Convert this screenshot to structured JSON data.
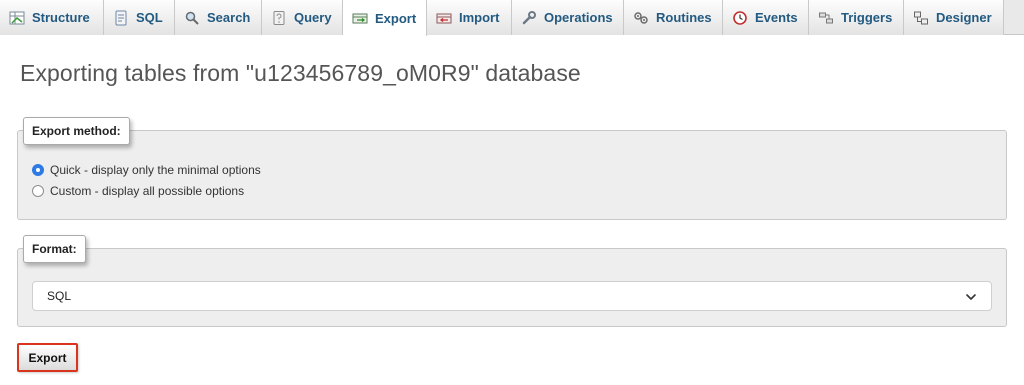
{
  "tabs": [
    {
      "id": "structure",
      "label": "Structure",
      "icon": "structure-icon"
    },
    {
      "id": "sql",
      "label": "SQL",
      "icon": "sql-icon"
    },
    {
      "id": "search",
      "label": "Search",
      "icon": "search-icon"
    },
    {
      "id": "query",
      "label": "Query",
      "icon": "query-icon"
    },
    {
      "id": "export",
      "label": "Export",
      "icon": "export-icon",
      "active": true
    },
    {
      "id": "import",
      "label": "Import",
      "icon": "import-icon"
    },
    {
      "id": "operations",
      "label": "Operations",
      "icon": "wrench-icon"
    },
    {
      "id": "routines",
      "label": "Routines",
      "icon": "routines-icon"
    },
    {
      "id": "events",
      "label": "Events",
      "icon": "clock-icon"
    },
    {
      "id": "triggers",
      "label": "Triggers",
      "icon": "triggers-icon"
    },
    {
      "id": "designer",
      "label": "Designer",
      "icon": "designer-icon"
    }
  ],
  "page": {
    "title": "Exporting tables from \"u123456789_oM0R9\" database"
  },
  "export_method": {
    "legend": "Export method:",
    "options": [
      {
        "label": "Quick - display only the minimal options",
        "checked": true
      },
      {
        "label": "Custom - display all possible options",
        "checked": false
      }
    ]
  },
  "format": {
    "legend": "Format:",
    "selected": "SQL"
  },
  "actions": {
    "export_label": "Export"
  },
  "colors": {
    "tab_text": "#235a81",
    "accent_radio": "#2f7ae5",
    "highlight_border": "#d9341e"
  }
}
